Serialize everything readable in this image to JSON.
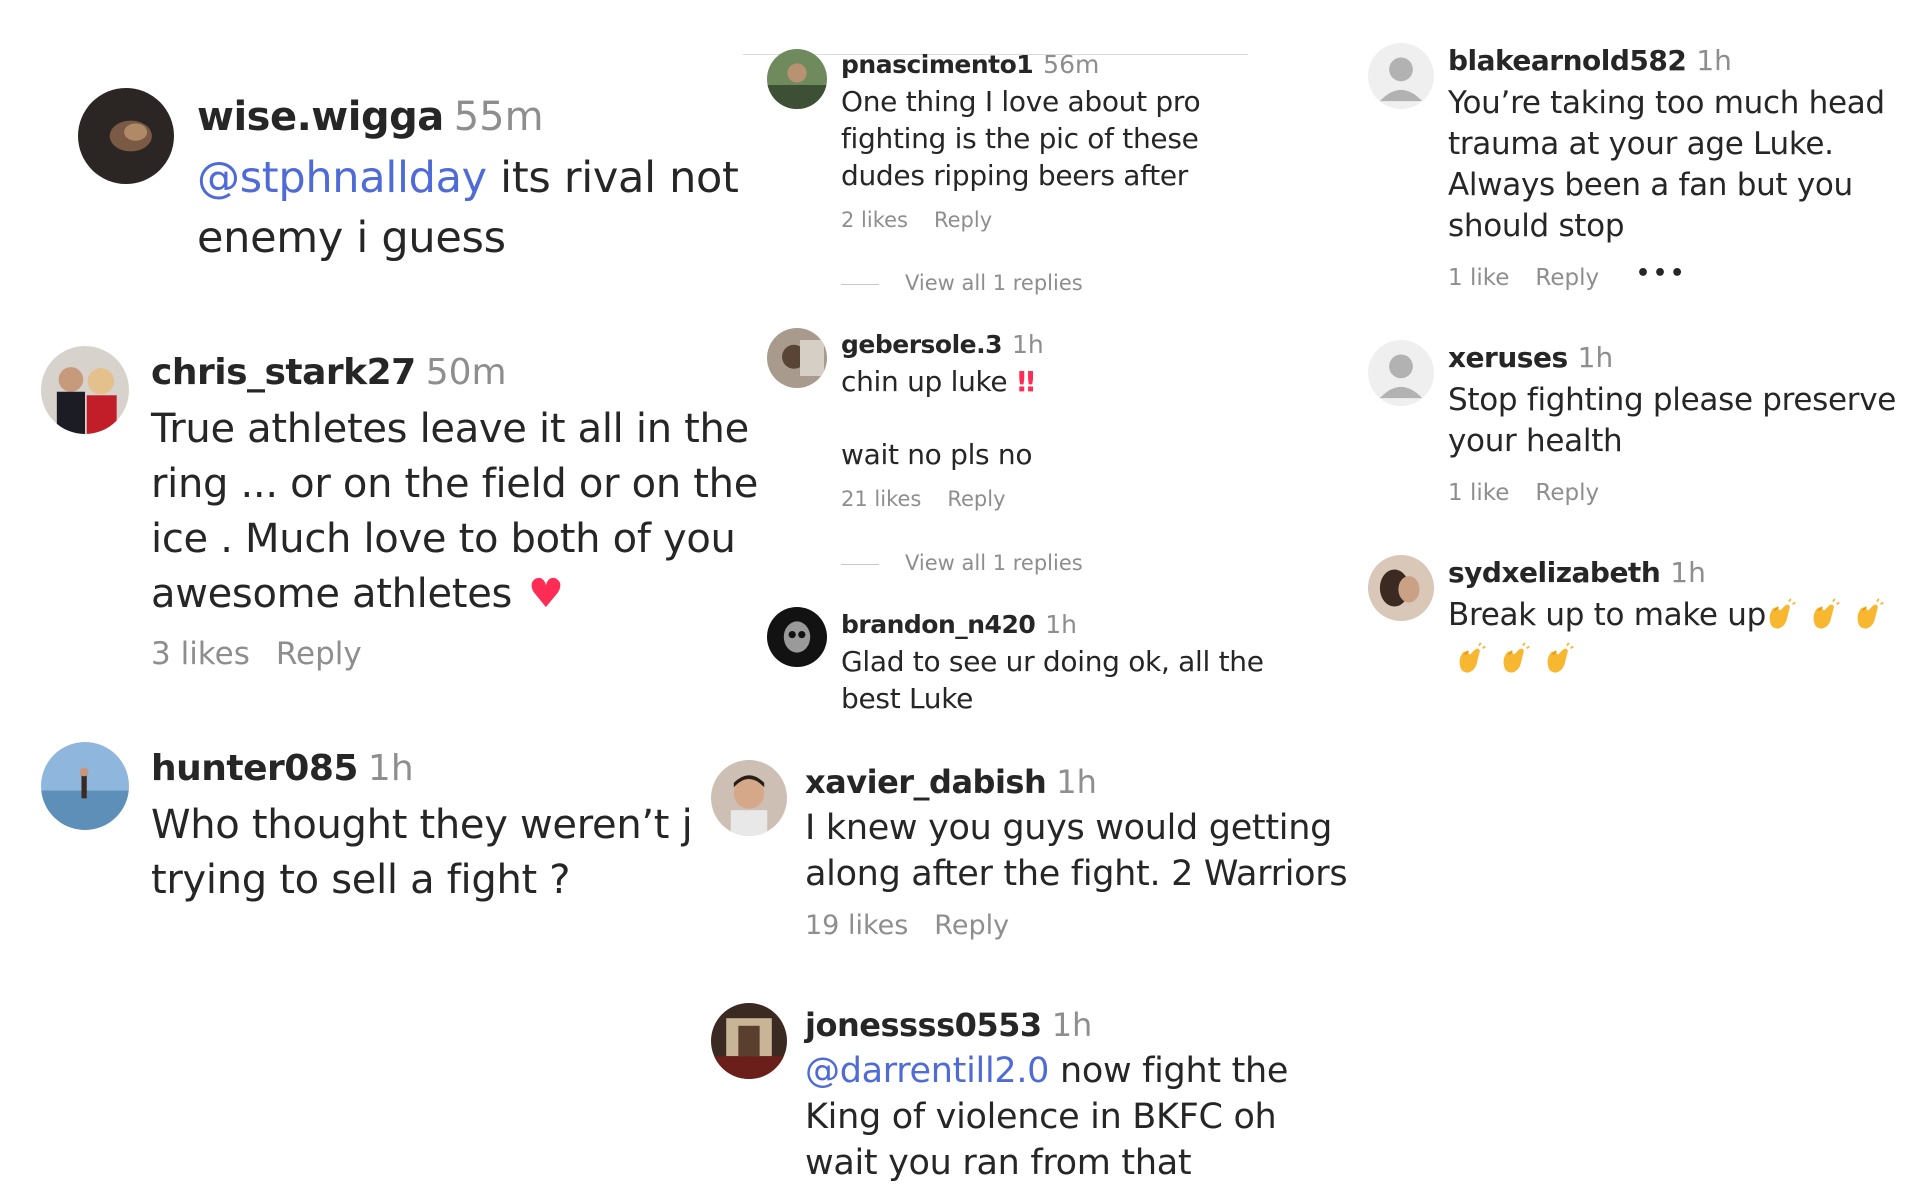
{
  "comments": [
    {
      "username": "wise.wigga",
      "time": "55m",
      "mention": "@stphnallday",
      "text": " its rival not\nenemy i guess"
    },
    {
      "username": "chris_stark27",
      "time": "50m",
      "text": "True athletes leave it all in the\nring ... or on the field or on the\nice . Much love to both of you\nawesome athletes",
      "emoji": "♥",
      "likes": "3 likes",
      "reply": "Reply"
    },
    {
      "username": "hunter085",
      "time": "1h",
      "text": "Who thought they weren’t j\ntrying to sell a fight ?"
    },
    {
      "username": "pnascimento1",
      "time": "56m",
      "text": "One thing I love about pro\nfighting is the pic of these\ndudes ripping beers after",
      "likes": "2 likes",
      "reply": "Reply",
      "view_replies": "View all 1 replies"
    },
    {
      "username": "gebersole.3",
      "time": "1h",
      "text": "chin up luke",
      "emoji": "‼",
      "text2": "wait no pls no",
      "likes": "21 likes",
      "reply": "Reply",
      "view_replies": "View all 1 replies"
    },
    {
      "username": "brandon_n420",
      "time": "1h",
      "text": "Glad to see ur doing ok, all the\nbest Luke"
    },
    {
      "username": "xavier_dabish",
      "time": "1h",
      "text": "I knew you guys would getting\nalong after the fight. 2 Warriors",
      "likes": "19 likes",
      "reply": "Reply"
    },
    {
      "username": "jonessss0553",
      "time": "1h",
      "mention": "@darrentill2.0",
      "text": " now fight the\nKing of violence in BKFC oh\nwait you ran from that"
    },
    {
      "username": "blakearnold582",
      "time": "1h",
      "text": "You’re taking too much head\ntrauma at your age Luke.\nAlways been a fan but you\nshould stop",
      "likes": "1 like",
      "reply": "Reply",
      "more": "•••"
    },
    {
      "username": "xeruses",
      "time": "1h",
      "text": "Stop fighting please preserve\nyour health",
      "likes": "1 like",
      "reply": "Reply"
    },
    {
      "username": "sydxelizabeth",
      "time": "1h",
      "text": "Break up to make up",
      "emoji_icon": "clapping-hands-icon",
      "emoji_count": 6
    }
  ],
  "colors": {
    "mention": "#4f6bd7",
    "meta": "#8e8e8e",
    "heart": "#ff2c55"
  }
}
